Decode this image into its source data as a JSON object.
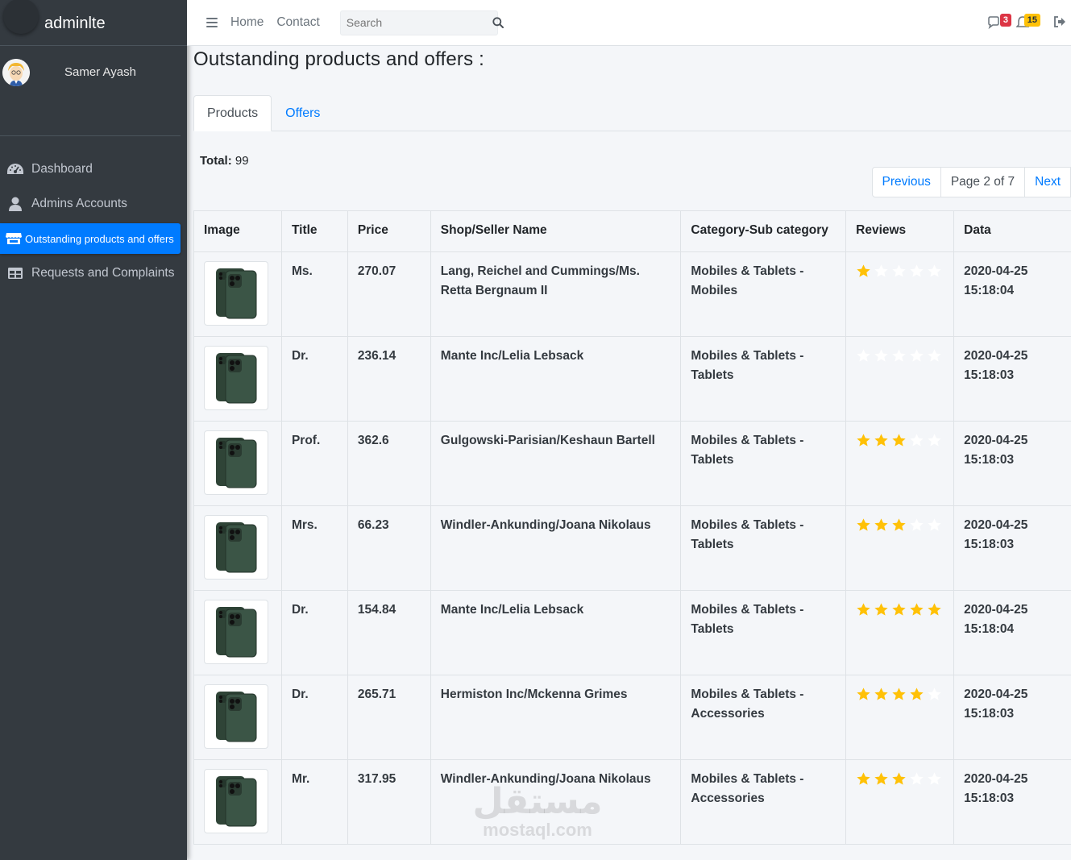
{
  "brand": {
    "name": "adminlte"
  },
  "user": {
    "name": "Samer Ayash"
  },
  "sidebar": {
    "items": [
      {
        "label": "Dashboard",
        "icon": "dashboard-icon",
        "active": false
      },
      {
        "label": "Admins Accounts",
        "icon": "user-icon",
        "active": false
      },
      {
        "label": "Outstanding products and offers",
        "icon": "store-icon",
        "active": true
      },
      {
        "label": "Requests and Complaints",
        "icon": "table-icon",
        "active": false
      }
    ]
  },
  "navbar": {
    "links": [
      "Home",
      "Contact"
    ],
    "search_placeholder": "Search",
    "messages_count": "3",
    "notifications_count": "15"
  },
  "page": {
    "title": "Outstanding products and offers :",
    "tabs": [
      {
        "label": "Products",
        "active": true
      },
      {
        "label": "Offers",
        "active": false
      }
    ],
    "total_label": "Total:",
    "total_value": "99",
    "pagination": {
      "previous": "Previous",
      "current": "Page 2 of 7",
      "next": "Next"
    }
  },
  "table": {
    "columns": [
      "Image",
      "Title",
      "Price",
      "Shop/Seller Name",
      "Category-Sub category",
      "Reviews",
      "Data"
    ],
    "rows": [
      {
        "title": "Ms.",
        "price": "270.07",
        "seller": "Lang, Reichel and Cummings/Ms. Retta Bergnaum II",
        "category": "Mobiles & Tablets - Mobiles",
        "rating": 1,
        "date": "2020-04-25 15:18:04"
      },
      {
        "title": "Dr.",
        "price": "236.14",
        "seller": "Mante Inc/Lelia Lebsack",
        "category": "Mobiles & Tablets - Tablets",
        "rating": 0,
        "date": "2020-04-25 15:18:03"
      },
      {
        "title": "Prof.",
        "price": "362.6",
        "seller": "Gulgowski-Parisian/Keshaun Bartell",
        "category": "Mobiles & Tablets - Tablets",
        "rating": 3,
        "date": "2020-04-25 15:18:03"
      },
      {
        "title": "Mrs.",
        "price": "66.23",
        "seller": "Windler-Ankunding/Joana Nikolaus",
        "category": "Mobiles & Tablets - Tablets",
        "rating": 3,
        "date": "2020-04-25 15:18:03"
      },
      {
        "title": "Dr.",
        "price": "154.84",
        "seller": "Mante Inc/Lelia Lebsack",
        "category": "Mobiles & Tablets - Tablets",
        "rating": 5,
        "date": "2020-04-25 15:18:04"
      },
      {
        "title": "Dr.",
        "price": "265.71",
        "seller": "Hermiston Inc/Mckenna Grimes",
        "category": "Mobiles & Tablets - Accessories",
        "rating": 4,
        "date": "2020-04-25 15:18:03"
      },
      {
        "title": "Mr.",
        "price": "317.95",
        "seller": "Windler-Ankunding/Joana Nikolaus",
        "category": "Mobiles & Tablets - Accessories",
        "rating": 3,
        "date": "2020-04-25 15:18:03"
      }
    ]
  },
  "colors": {
    "sidebar_bg": "#343a40",
    "active": "#007bff",
    "star_on": "#ffc107",
    "star_off": "#ffffff"
  },
  "watermark": {
    "arabic": "مستقل",
    "latin": "mostaql.com"
  }
}
